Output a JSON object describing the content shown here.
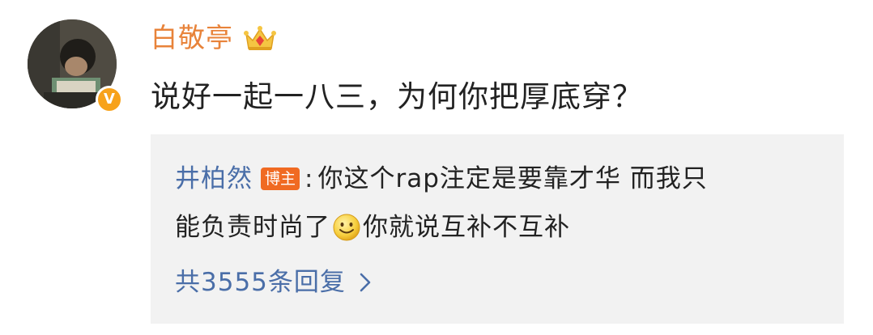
{
  "comment": {
    "username": "白敬亭",
    "verified_badge": "V",
    "text": "说好一起一八三，为何你把厚底穿？",
    "colors": {
      "username": "#e8833a",
      "verified_badge": "#f7a21b"
    }
  },
  "reply": {
    "author": "井柏然",
    "author_badge": "博主",
    "separator": ":",
    "text_part1": "你这个rap注定是要靠才华 而我只",
    "text_part2": "能负责时尚了",
    "emoji": "smile-icon",
    "text_part3": "你就说互补不互补",
    "more_replies": "共3555条回复",
    "colors": {
      "author": "#4a6ea8",
      "author_badge": "#f06a22",
      "background": "#f2f2f2"
    }
  }
}
